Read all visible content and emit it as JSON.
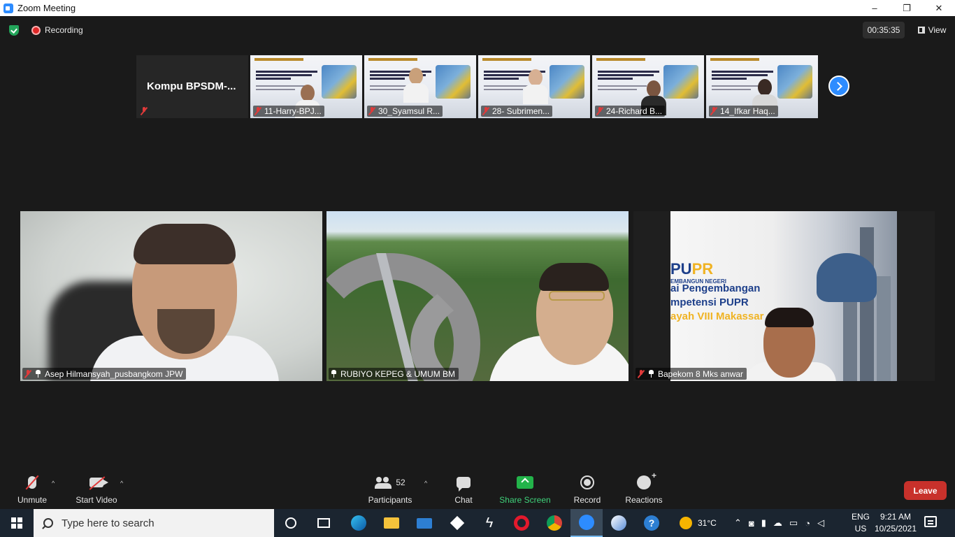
{
  "window": {
    "title": "Zoom Meeting",
    "minimize": "–",
    "maximize": "❐",
    "close": "✕"
  },
  "status": {
    "recording_label": "Recording",
    "timer": "00:35:35",
    "view_label": "View"
  },
  "gallery_strip": {
    "first_tile_name": "Kompu  BPSDM-...",
    "thumbnails": [
      {
        "name": "11-Harry-BPJ..."
      },
      {
        "name": "30_Syamsul R..."
      },
      {
        "name": "28- Subrimen..."
      },
      {
        "name": "24-Richard B..."
      },
      {
        "name": "14_Ifkar Haq..."
      }
    ]
  },
  "main_tiles": [
    {
      "name": "Asep Hilmansyah_pusbangkom JPW"
    },
    {
      "name": "RUBIYO KEPEG & UMUM BM"
    },
    {
      "name": "Bapekom 8 Mks anwar"
    }
  ],
  "slide_text": {
    "pupr": "PU",
    "pupr_accent": "PR",
    "small": "EMBANGUN NEGERI",
    "line1": "ai Pengembangan",
    "line2": "mpetensi PUPR",
    "line3": "ayah VIII Makassar"
  },
  "toolbar": {
    "unmute": "Unmute",
    "start_video": "Start Video",
    "participants": "Participants",
    "participants_count": "52",
    "chat": "Chat",
    "share_screen": "Share Screen",
    "record": "Record",
    "reactions": "Reactions",
    "leave": "Leave",
    "caret": "^"
  },
  "taskbar": {
    "search_placeholder": "Type here to search",
    "weather": "31°C",
    "lang_top": "ENG",
    "lang_bottom": "US",
    "time": "9:21 AM",
    "date": "10/25/2021"
  },
  "colors": {
    "zoom_blue": "#2d8cff",
    "leave_red": "#c8312b",
    "share_green": "#23b34a",
    "recording_red": "#e02828"
  }
}
